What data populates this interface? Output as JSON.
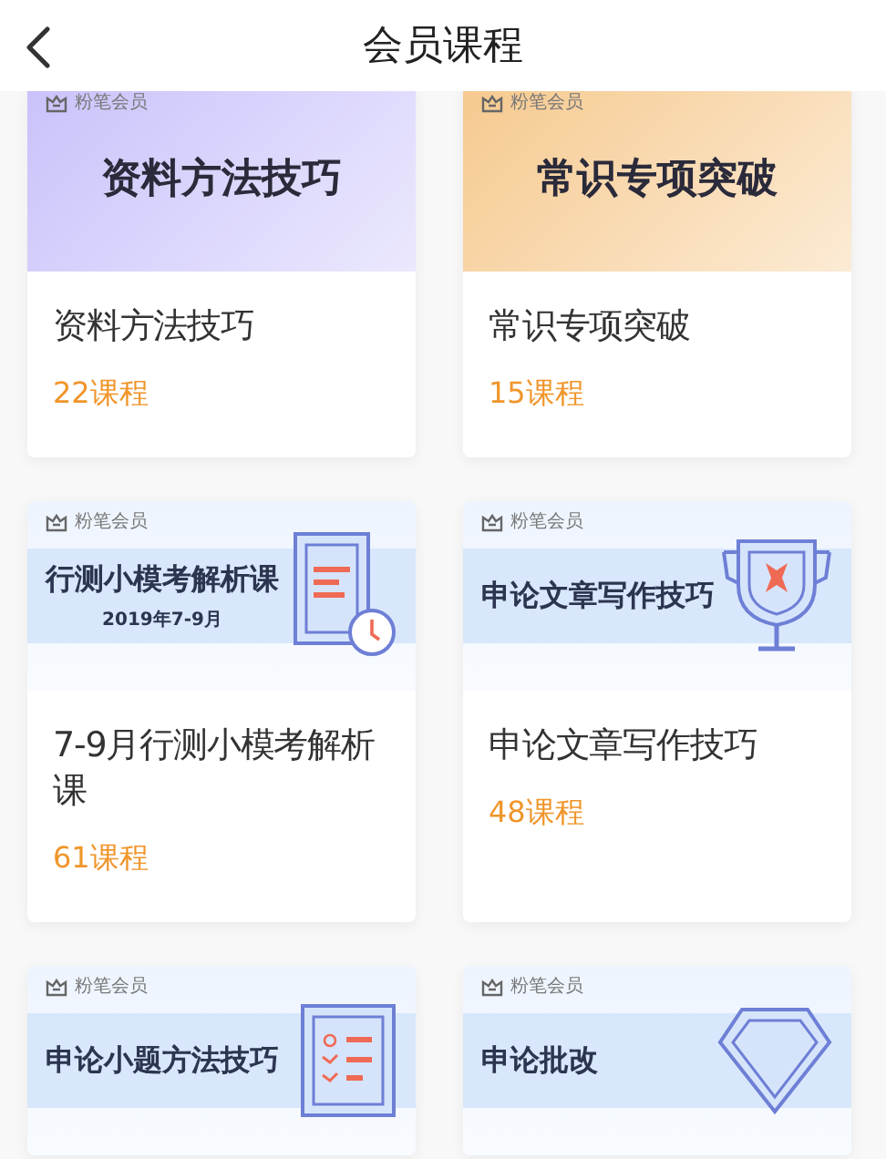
{
  "header": {
    "title": "会员课程"
  },
  "courses": [
    {
      "title": "资料方法技巧",
      "count": "22课程",
      "banner": {
        "kind": "gradient",
        "color": "#c9c2fb",
        "brand": "粉笔会员",
        "title": "资料方法技巧"
      }
    },
    {
      "title": "常识专项突破",
      "count": "15课程",
      "banner": {
        "kind": "gradient",
        "color": "#f6c98e",
        "brand": "粉笔会员",
        "title": "常识专项突破"
      }
    },
    {
      "title": "7-9月行测小模考解析课",
      "count": "61课程",
      "banner": {
        "kind": "document",
        "brand": "粉笔会员",
        "title": "行测小模考解析课",
        "subtitle": "2019年7-9月"
      }
    },
    {
      "title": "申论文章写作技巧",
      "count": "48课程",
      "banner": {
        "kind": "trophy",
        "brand": "粉笔会员",
        "title": "申论文章写作技巧"
      }
    },
    {
      "banner": {
        "kind": "checklist",
        "brand": "粉笔会员",
        "title": "申论小题方法技巧"
      }
    },
    {
      "banner": {
        "kind": "diamond",
        "brand": "粉笔会员",
        "title": "申论批改"
      }
    }
  ]
}
